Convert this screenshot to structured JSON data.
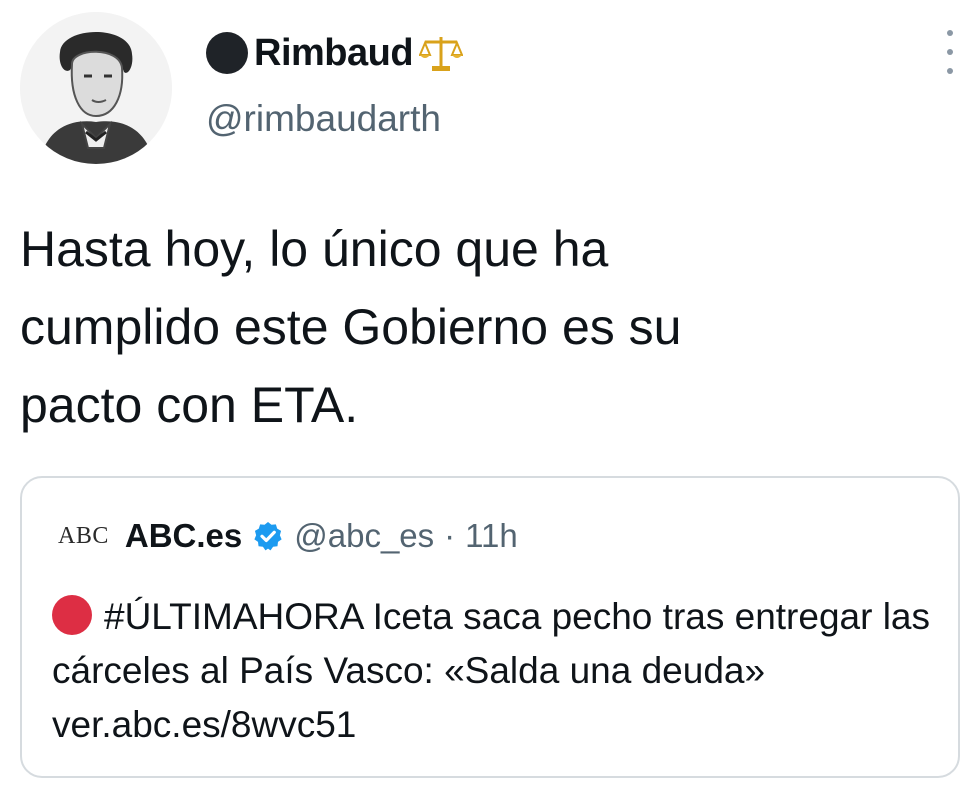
{
  "author": {
    "display_name": "Rimbaud",
    "handle": "@rimbaudarth",
    "name_prefix_icon": "black-circle-emoji",
    "name_suffix_icon": "balance-scale-emoji"
  },
  "tweet": {
    "text": "Hasta hoy, lo único que ha\ncumplido este Gobierno es su\npacto con ETA."
  },
  "quoted_tweet": {
    "logo_text": "ABC",
    "display_name": "ABC.es",
    "verified": true,
    "handle": "@abc_es",
    "separator": "·",
    "time": "11h",
    "bullet_icon": "red-circle-emoji",
    "text": "#ÚLTIMAHORA Iceta saca pecho tras entregar las cárceles al País Vasco: «Salda una deuda» ver.abc.es/8wvc51"
  },
  "colors": {
    "text": "#0f1419",
    "secondary": "#536471",
    "border": "#d6dbdf",
    "verified_blue": "#1d9bf0",
    "red_circle": "#dd2e44"
  }
}
